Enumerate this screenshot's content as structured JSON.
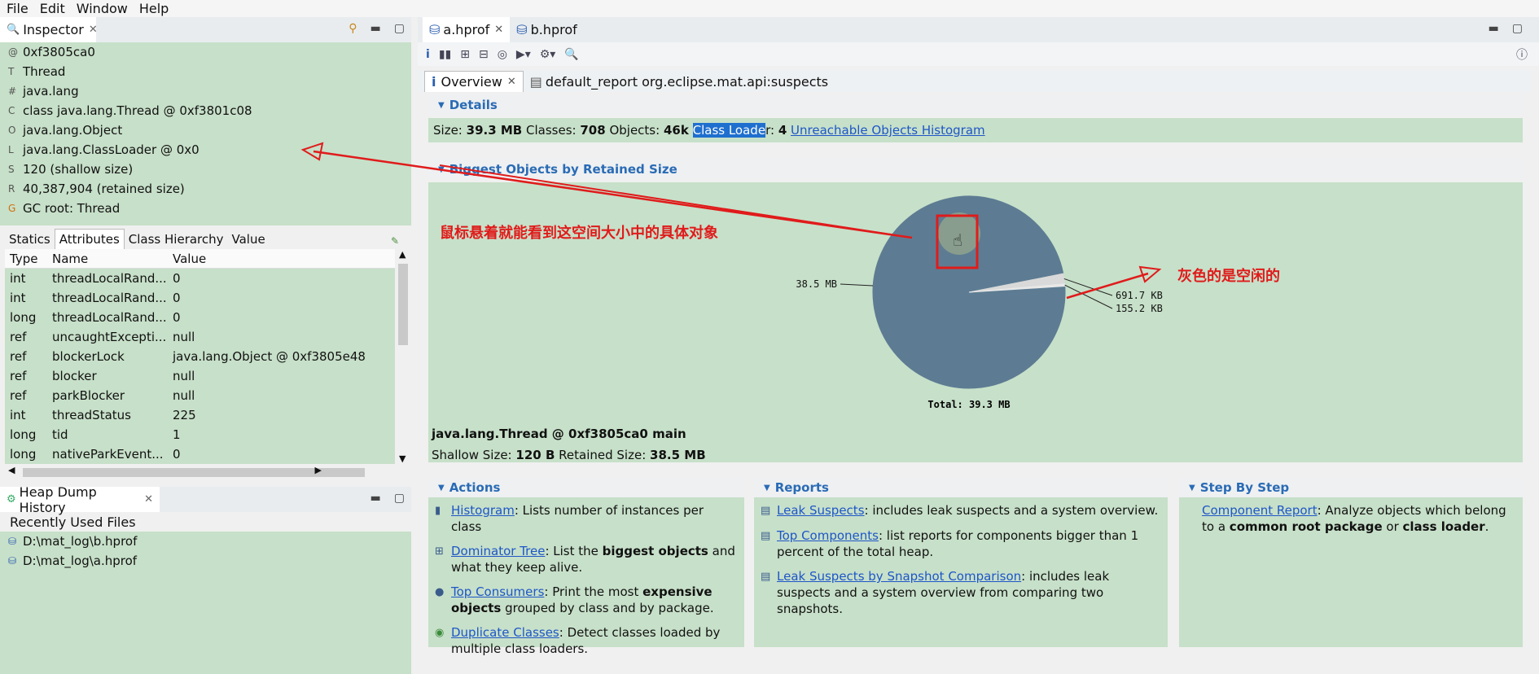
{
  "menu": [
    "File",
    "Edit",
    "Window",
    "Help"
  ],
  "inspector": {
    "title": "Inspector",
    "rows": [
      {
        "icon": "@",
        "text": "0xf3805ca0"
      },
      {
        "icon": "T",
        "text": "Thread"
      },
      {
        "icon": "#",
        "text": "java.lang"
      },
      {
        "icon": "C",
        "text": "class java.lang.Thread @ 0xf3801c08"
      },
      {
        "icon": "O",
        "text": "java.lang.Object"
      },
      {
        "icon": "L",
        "text": "java.lang.ClassLoader @ 0x0"
      },
      {
        "icon": "S",
        "text": "120 (shallow size)"
      },
      {
        "icon": "R",
        "text": "40,387,904 (retained size)"
      },
      {
        "icon": "G",
        "text": "GC root: Thread"
      }
    ],
    "sub_tabs": [
      "Statics",
      "Attributes",
      "Class Hierarchy",
      "Value"
    ],
    "columns": [
      "Type",
      "Name",
      "Value"
    ],
    "attributes": [
      {
        "type": "int",
        "name": "threadLocalRand...",
        "value": "0"
      },
      {
        "type": "int",
        "name": "threadLocalRand...",
        "value": "0"
      },
      {
        "type": "long",
        "name": "threadLocalRand...",
        "value": "0"
      },
      {
        "type": "ref",
        "name": "uncaughtExcepti...",
        "value": "null"
      },
      {
        "type": "ref",
        "name": "blockerLock",
        "value": "java.lang.Object @ 0xf3805e48"
      },
      {
        "type": "ref",
        "name": "blocker",
        "value": "null"
      },
      {
        "type": "ref",
        "name": "parkBlocker",
        "value": "null"
      },
      {
        "type": "int",
        "name": "threadStatus",
        "value": "225"
      },
      {
        "type": "long",
        "name": "tid",
        "value": "1"
      },
      {
        "type": "long",
        "name": "nativeParkEvent...",
        "value": "0"
      }
    ]
  },
  "heap_history": {
    "title": "Heap Dump History",
    "recent_label": "Recently Used Files",
    "files": [
      "D:\\mat_log\\b.hprof",
      "D:\\mat_log\\a.hprof"
    ]
  },
  "editor": {
    "tabs": [
      "a.hprof",
      "b.hprof"
    ],
    "pane_tabs": [
      "Overview",
      "default_report  org.eclipse.mat.api:suspects"
    ],
    "details": {
      "title": "Details",
      "size_label": "Size:",
      "size_value": "39.3 MB",
      "classes_label": "Classes:",
      "classes_value": "708",
      "objects_label": "Objects:",
      "objects_value": "46k",
      "loader_label_hl": "Class Loade",
      "loader_label_rest": "r:",
      "loader_value": "4",
      "link": "Unreachable Objects Histogram"
    },
    "biggest": {
      "title": "Biggest Objects by Retained Size",
      "selected_object": "java.lang.Thread @ 0xf3805ca0 main",
      "shallow_label": "Shallow Size:",
      "shallow_value": "120 B",
      "retained_label": "Retained Size:",
      "retained_value": "38.5 MB"
    },
    "actions": {
      "title": "Actions",
      "items": [
        {
          "link": "Histogram",
          "pre": ": Lists number of instances per class",
          "bold": "",
          "post": ""
        },
        {
          "link": "Dominator Tree",
          "pre": ": List the ",
          "bold": "biggest objects",
          "post": " and what they keep alive."
        },
        {
          "link": "Top Consumers",
          "pre": ": Print the most ",
          "bold": "expensive objects",
          "post": " grouped by class and by package."
        },
        {
          "link": "Duplicate Classes",
          "pre": ": Detect classes loaded by multiple class loaders.",
          "bold": "",
          "post": ""
        }
      ]
    },
    "reports": {
      "title": "Reports",
      "items": [
        {
          "link": "Leak Suspects",
          "text": ": includes leak suspects and a system overview."
        },
        {
          "link": "Top Components",
          "text": ": list reports for components bigger than 1 percent of the total heap."
        },
        {
          "link": "Leak Suspects by Snapshot Comparison",
          "text": ": includes leak suspects and a system overview from comparing two snapshots."
        }
      ]
    },
    "step": {
      "title": "Step By Step",
      "link": "Component Report",
      "pre": ": Analyze objects which belong to a ",
      "bold1": "common root package",
      "mid": " or ",
      "bold2": "class loader",
      "post": "."
    }
  },
  "chart_data": {
    "type": "pie",
    "slices": [
      {
        "label": "38.5 MB",
        "value": 38.5,
        "color": "#5d7c93"
      },
      {
        "label": "691.7 KB",
        "value": 0.6755,
        "color": "#d9d9d9"
      },
      {
        "label": "155.2 KB",
        "value": 0.1516,
        "color": "#e8e8e8"
      }
    ],
    "total_label": "Total: 39.3 MB"
  },
  "annotations": {
    "hover_note": "鼠标悬着就能看到这空间大小中的具体对象",
    "gray_note": "灰色的是空闲的"
  },
  "colors": {
    "panel_green": "#c7e0c9",
    "link": "#1e56c8",
    "annotation": "#e01b1b"
  }
}
